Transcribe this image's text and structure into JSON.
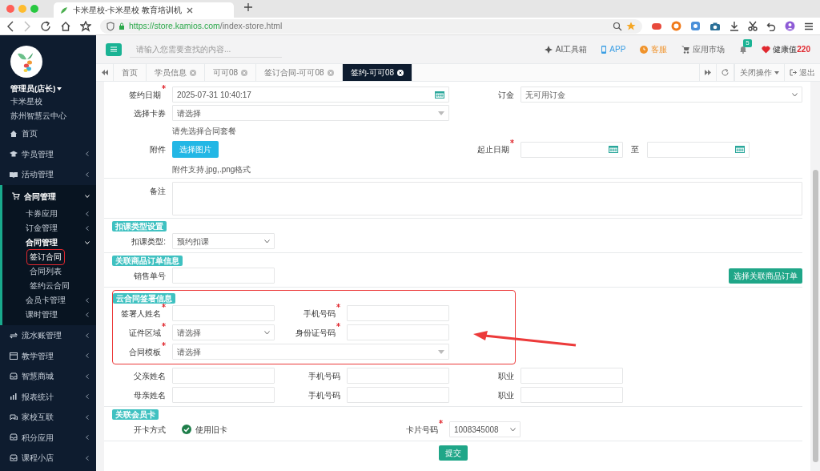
{
  "browser": {
    "tab_title": "卡米星校-卡米星校 教育培训机",
    "url_host": "https://store.kamios.com",
    "url_path": "/index-store.html"
  },
  "sidebar": {
    "user": "管理员(店长)",
    "org": "卡米星校",
    "center": "苏州智慧云中心",
    "items": [
      {
        "label": "首页"
      },
      {
        "label": "学员管理",
        "expanded": false
      },
      {
        "label": "活动管理",
        "expanded": false
      },
      {
        "label": "合同管理",
        "expanded": true,
        "children": [
          {
            "label": "卡券应用",
            "expanded": false
          },
          {
            "label": "订金管理",
            "expanded": false
          },
          {
            "label": "合同管理",
            "expanded": true,
            "children": [
              {
                "label": "签订合同",
                "selected": true
              },
              {
                "label": "合同列表",
                "selected": false
              },
              {
                "label": "签约云合同",
                "selected": false
              }
            ]
          },
          {
            "label": "会员卡管理",
            "expanded": false
          },
          {
            "label": "课时管理",
            "expanded": false
          }
        ]
      },
      {
        "label": "流水账管理",
        "expanded": false
      },
      {
        "label": "教学管理",
        "expanded": false
      },
      {
        "label": "智慧商城",
        "expanded": false
      },
      {
        "label": "报表统计",
        "expanded": false
      },
      {
        "label": "家校互联",
        "expanded": false
      },
      {
        "label": "积分应用",
        "expanded": false
      },
      {
        "label": "课程小店",
        "expanded": false
      }
    ]
  },
  "header": {
    "search_placeholder": "请输入您需要查找的内容...",
    "links": [
      {
        "label": "AI工具箱",
        "color": "#555555"
      },
      {
        "label": "APP",
        "color": "#3a9ee4"
      },
      {
        "label": "客服",
        "color": "#f0932b"
      },
      {
        "label": "应用市场",
        "color": "#666666"
      }
    ],
    "notifications": "5",
    "health_label": "健康值",
    "health_value": "220"
  },
  "tabs": [
    {
      "label": "首页",
      "closable": false,
      "selected": false
    },
    {
      "label": "学员信息",
      "closable": true,
      "selected": false
    },
    {
      "label": "可可08",
      "closable": true,
      "selected": false
    },
    {
      "label": "签订合同-可可08",
      "closable": true,
      "selected": false
    },
    {
      "label": "签约-可可08",
      "closable": true,
      "selected": true
    }
  ],
  "tab_actions": {
    "close_menu": "关闭操作",
    "logout": "退出"
  },
  "form": {
    "sign_date": {
      "label": "签约日期",
      "required": true,
      "value": "2025-07-31 10:40:17"
    },
    "deposit": {
      "label": "订金",
      "required": false,
      "value": "无可用订金"
    },
    "card_coupon": {
      "label": "选择卡券",
      "required": false,
      "value": "请选择",
      "hint": "请先选择合同套餐"
    },
    "attachment": {
      "label": "附件",
      "button": "选择图片",
      "hint": "附件支持.jpg,.png格式"
    },
    "period": {
      "label": "起止日期",
      "required": true,
      "separator": "至"
    },
    "remark": {
      "label": "备注"
    },
    "blocks": [
      {
        "kind": "section",
        "title": "扣课类型设置",
        "highlighted": false,
        "rows": [
          [
            {
              "label": "扣课类型:",
              "required": false,
              "kind": "select",
              "value": "预约扣课"
            }
          ]
        ]
      },
      {
        "kind": "section",
        "title": "关联商品订单信息",
        "highlighted": false,
        "rows": [
          [
            {
              "label": "销售单号",
              "required": false,
              "kind": "input"
            },
            {
              "kind": "action",
              "text": "选择关联商品订单"
            }
          ]
        ]
      },
      {
        "kind": "section",
        "title": "云合同签署信息",
        "highlighted": true,
        "rows": [
          [
            {
              "label": "签署人姓名",
              "required": true,
              "kind": "input"
            },
            {
              "label": "手机号码",
              "required": true,
              "kind": "input"
            }
          ],
          [
            {
              "label": "证件区域",
              "required": true,
              "kind": "select",
              "value": "请选择"
            },
            {
              "label": "身份证号码",
              "required": true,
              "kind": "input"
            }
          ],
          [
            {
              "label": "合同模板",
              "required": true,
              "kind": "combo",
              "value": "请选择"
            }
          ]
        ]
      },
      {
        "kind": "plain",
        "rows": [
          [
            {
              "label": "父亲姓名",
              "required": false,
              "kind": "input"
            },
            {
              "label": "手机号码",
              "required": false,
              "kind": "input"
            },
            {
              "label": "职业",
              "required": false,
              "kind": "input"
            }
          ],
          [
            {
              "label": "母亲姓名",
              "required": false,
              "kind": "input"
            },
            {
              "label": "手机号码",
              "required": false,
              "kind": "input"
            },
            {
              "label": "职业",
              "required": false,
              "kind": "input"
            }
          ]
        ]
      },
      {
        "kind": "section",
        "title": "关联会员卡",
        "highlighted": false,
        "rows": [
          [
            {
              "label": "开卡方式",
              "required": false,
              "kind": "check",
              "text": "使用旧卡",
              "checked": true
            },
            {
              "label": "卡片号码",
              "required": true,
              "kind": "select",
              "value": "1008345008"
            }
          ]
        ]
      }
    ],
    "submit": "提交"
  }
}
